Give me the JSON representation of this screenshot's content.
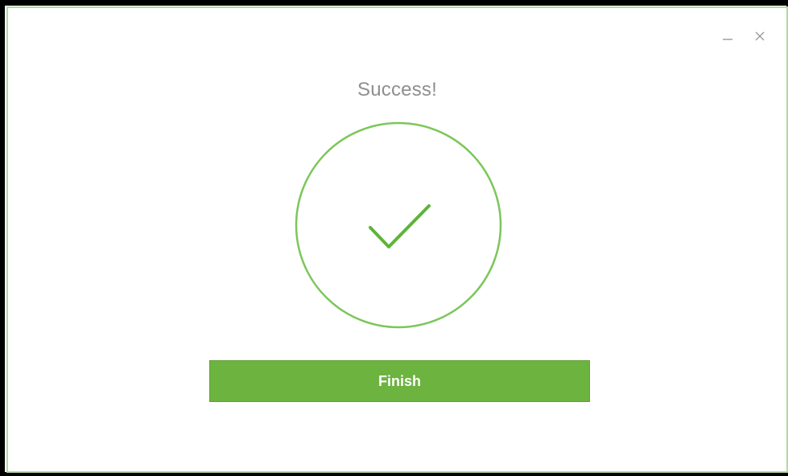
{
  "dialog": {
    "title": "Success!",
    "finish_label": "Finish"
  },
  "window_controls": {
    "minimize_icon": "minimize-icon",
    "close_icon": "close-icon"
  },
  "status": {
    "icon": "checkmark-icon"
  },
  "colors": {
    "accent": "#6cb33f",
    "circle_stroke": "#7cc65a",
    "title_text": "#8f8f8f",
    "window_border": "#b3d9a3"
  }
}
